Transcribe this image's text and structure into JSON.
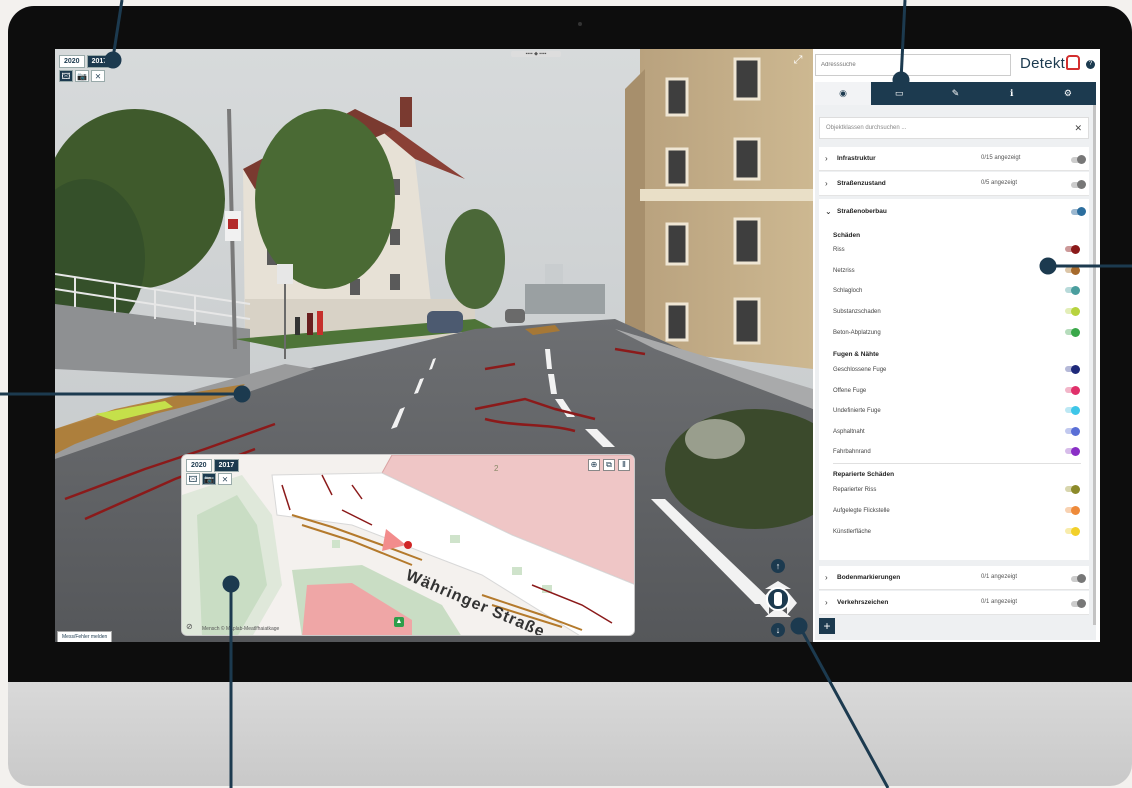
{
  "photo": {
    "years": [
      "2020",
      "2017"
    ],
    "active_year": "2017",
    "tools": [
      {
        "name": "image-icon",
        "glyph": "🖾"
      },
      {
        "name": "camera-icon",
        "glyph": "📷"
      },
      {
        "name": "hide-icon",
        "glyph": "⨯"
      }
    ],
    "report_label": "Mess/Fehler melden"
  },
  "minimap": {
    "years": [
      "2020",
      "2017"
    ],
    "street_name": "Währinger Straße",
    "credit": "Mensch © Maplab-Meatlfhaiatkage",
    "block_number": "2"
  },
  "sidebar": {
    "address_search_placeholder": "Adresssuche",
    "logo_text": "Detekt",
    "help": "?",
    "tabs": [
      {
        "name": "tab-view",
        "glyph": "◉"
      },
      {
        "name": "tab-measure",
        "glyph": "▭"
      },
      {
        "name": "tab-edit",
        "glyph": "✎"
      },
      {
        "name": "tab-info",
        "glyph": "ℹ"
      },
      {
        "name": "tab-settings",
        "glyph": "⚙"
      }
    ],
    "filter_placeholder": "Objektklassen durchsuchen ...",
    "collapsed_top": [
      {
        "label": "Infrastruktur",
        "count": "0/15 angezeigt"
      },
      {
        "label": "Straßenzustand",
        "count": "0/5 angezeigt"
      }
    ],
    "expanded_group": {
      "label": "Straßenoberbau",
      "sections": [
        {
          "title": "Schäden",
          "items": [
            {
              "label": "Riss",
              "color": "#8b1a1a"
            },
            {
              "label": "Netzriss",
              "color": "#a66a2c"
            },
            {
              "label": "Schlagloch",
              "color": "#4a9e9e"
            },
            {
              "label": "Substanzschaden",
              "color": "#b7d33e"
            },
            {
              "label": "Beton-Abplatzung",
              "color": "#3aa84a"
            }
          ]
        },
        {
          "title": "Fugen & Nähte",
          "items": [
            {
              "label": "Geschlossene Fuge",
              "color": "#1f2a7a"
            },
            {
              "label": "Offene Fuge",
              "color": "#e0306a"
            },
            {
              "label": "Undefinierte Fuge",
              "color": "#3ec6e8"
            },
            {
              "label": "Asphaltnaht",
              "color": "#5a6fd6"
            },
            {
              "label": "Fahrbahnrand",
              "color": "#8a2fc6"
            }
          ]
        },
        {
          "title": "Reparierte Schäden",
          "items": [
            {
              "label": "Reparierter Riss",
              "color": "#8c8a2a"
            },
            {
              "label": "Aufgelegte Flickstelle",
              "color": "#ee8a3a"
            },
            {
              "label": "Künstlerfläche",
              "color": "#f2d02a"
            }
          ]
        }
      ]
    },
    "collapsed_bottom": [
      {
        "label": "Bodenmarkierungen",
        "count": "0/1 angezeigt"
      },
      {
        "label": "Verkehrszeichen",
        "count": "0/1 angezeigt"
      }
    ],
    "add_label": "+"
  }
}
